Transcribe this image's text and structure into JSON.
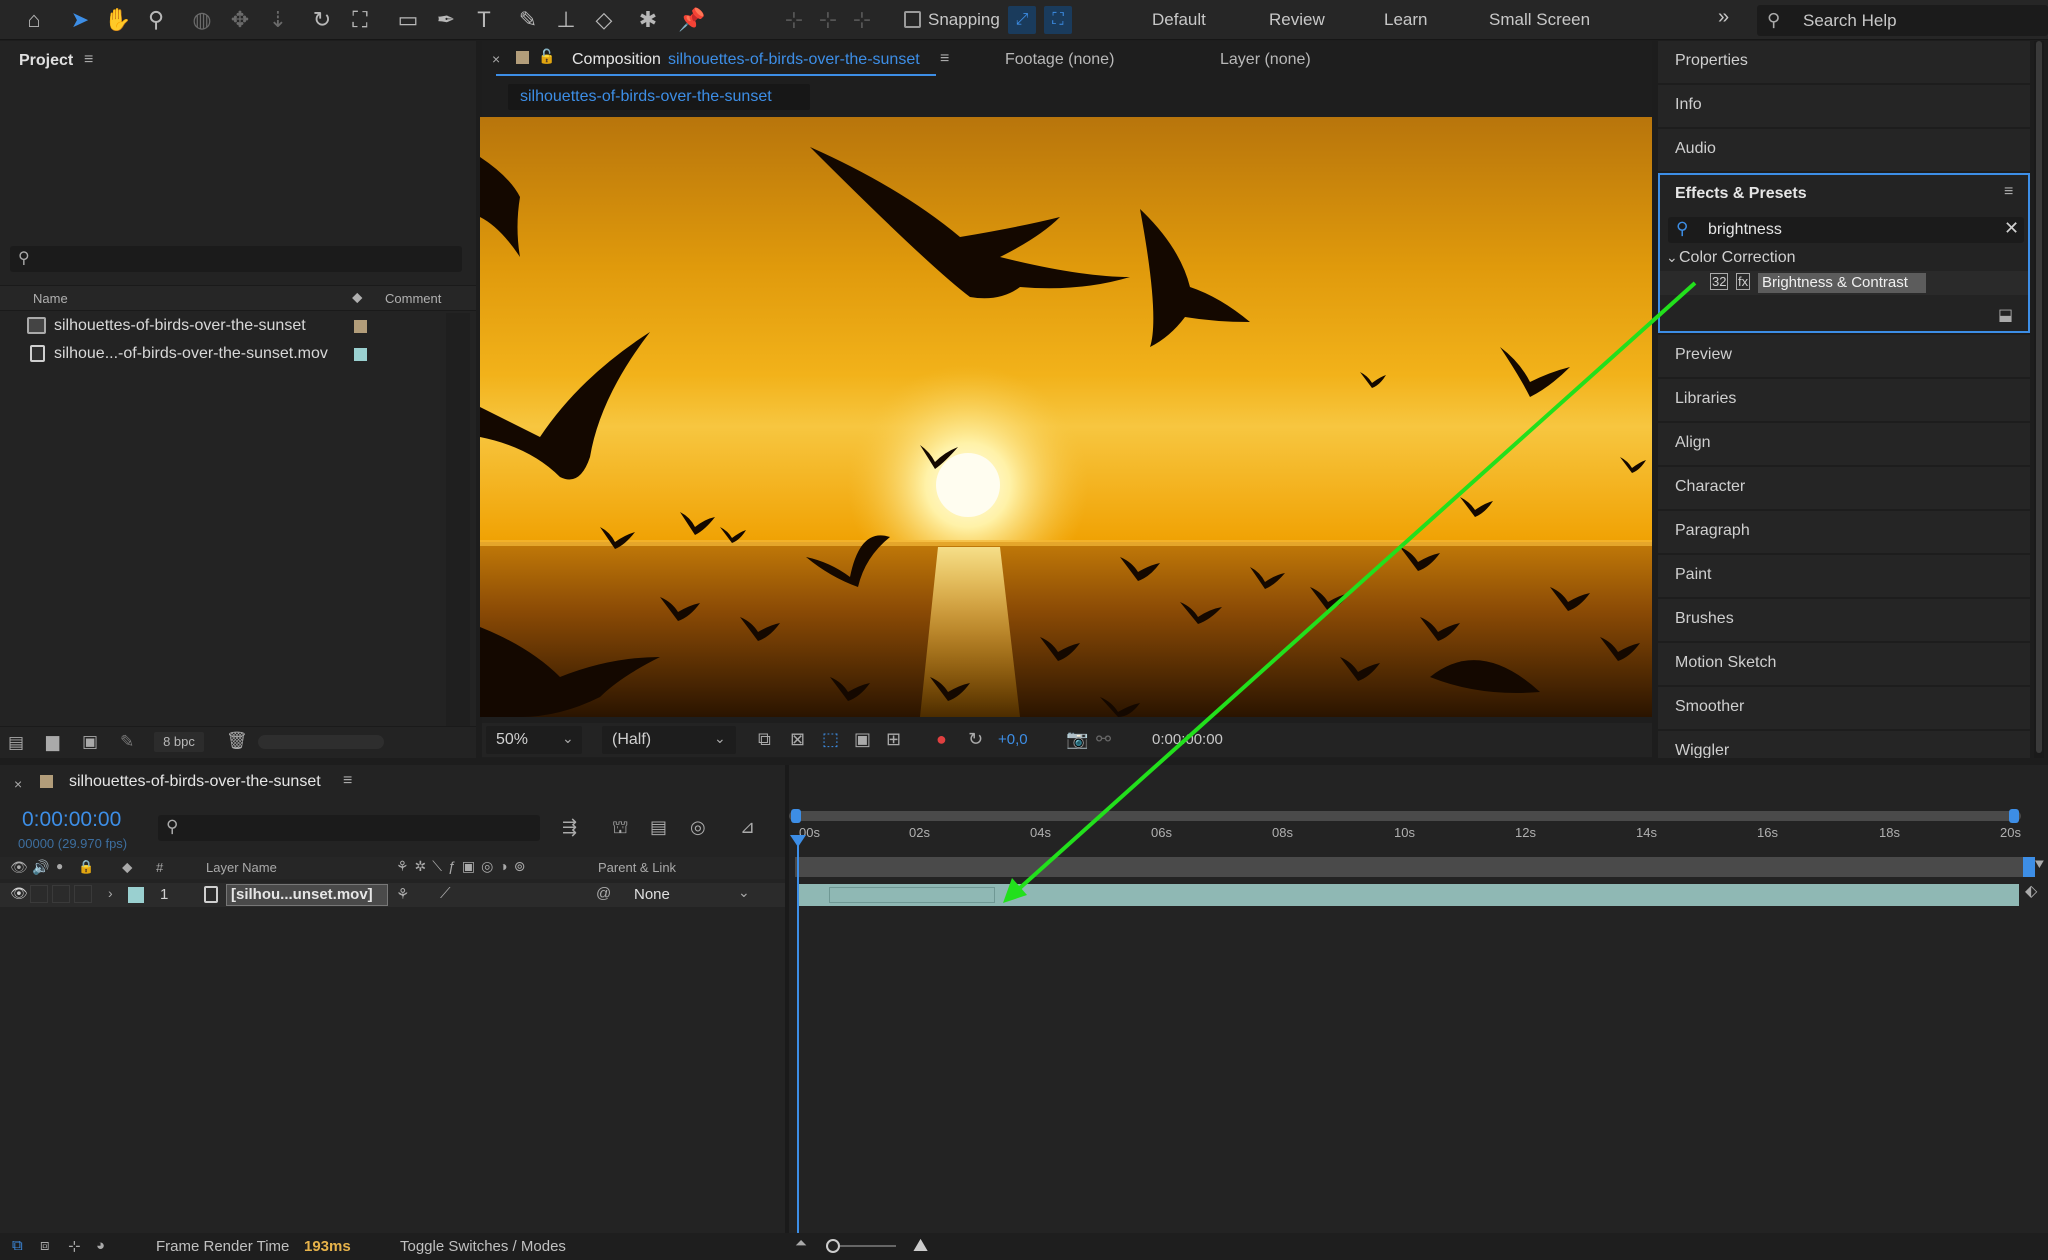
{
  "toolbar": {
    "snapping_label": "Snapping",
    "workspaces": [
      "Default",
      "Review",
      "Learn",
      "Small Screen"
    ],
    "search_help_placeholder": "Search Help"
  },
  "project": {
    "title": "Project",
    "col_name": "Name",
    "col_comment": "Comment",
    "items": [
      {
        "name": "silhouettes-of-birds-over-the-sunset",
        "color": "#b29d7a",
        "type": "composition"
      },
      {
        "name": "silhoue...-of-birds-over-the-sunset.mov",
        "color": "#9ad0d0",
        "type": "footage"
      }
    ],
    "bpc_label": "8 bpc"
  },
  "comp": {
    "tab_prefix": "Composition",
    "tab_comp_name": "silhouettes-of-birds-over-the-sunset",
    "footage_tab": "Footage (none)",
    "layer_tab": "Layer (none)",
    "sub_tab": "silhouettes-of-birds-over-the-sunset",
    "zoom": "50%",
    "resolution": "(Half)",
    "exposure": "+0,0",
    "timecode": "0:00:00:00"
  },
  "right": {
    "items_top": [
      "Properties",
      "Info",
      "Audio"
    ],
    "effects_title": "Effects & Presets",
    "effects_search": "brightness",
    "effects_category": "Color Correction",
    "effects_result": "Brightness & Contrast",
    "items_bottom": [
      "Preview",
      "Libraries",
      "Align",
      "Character",
      "Paragraph",
      "Paint",
      "Brushes",
      "Motion Sketch",
      "Smoother",
      "Wiggler"
    ]
  },
  "timeline": {
    "comp_name": "silhouettes-of-birds-over-the-sunset",
    "timecode": "0:00:00:00",
    "frame_info": "00000 (29.970 fps)",
    "col_hash": "#",
    "col_layer_name": "Layer Name",
    "col_parent": "Parent & Link",
    "ruler": [
      "00s",
      "02s",
      "04s",
      "06s",
      "08s",
      "10s",
      "12s",
      "14s",
      "16s",
      "18s",
      "20s"
    ],
    "layer": {
      "index": "1",
      "name": "[silhou...unset.mov]",
      "parent": "None",
      "color": "#9ad0d0"
    }
  },
  "status": {
    "frame_render_label": "Frame Render Time",
    "frame_render_value": "193ms",
    "toggle_label": "Toggle Switches / Modes"
  },
  "colors": {
    "accent": "#3d8ee6",
    "annotation_arrow": "#22e01c",
    "layer_bar": "#8fb8b4"
  }
}
